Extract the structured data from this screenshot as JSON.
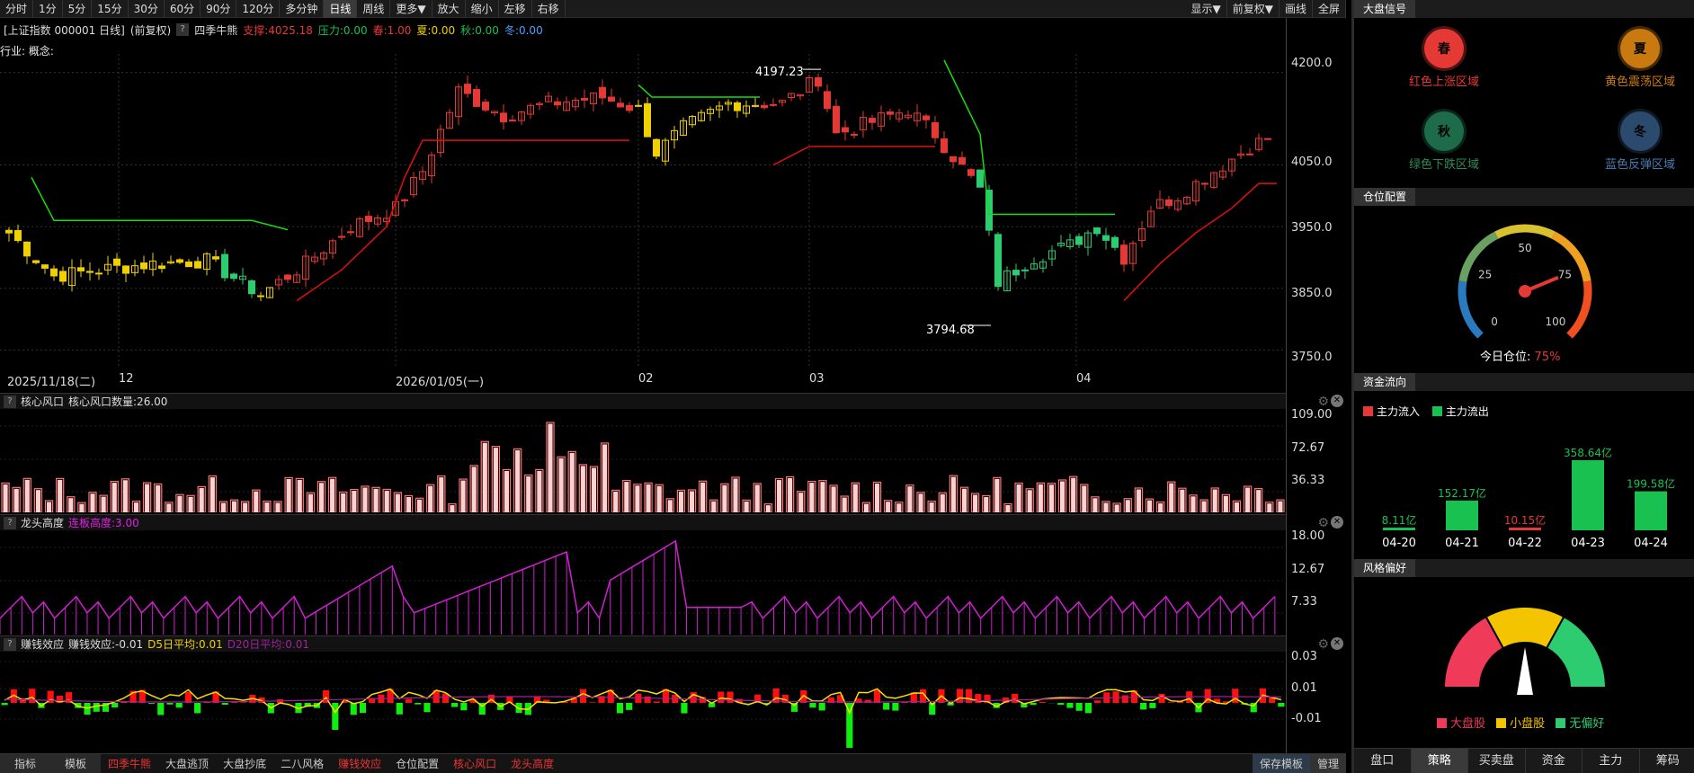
{
  "toolbar": {
    "periods": [
      "分时",
      "1分",
      "5分",
      "15分",
      "30分",
      "60分",
      "90分",
      "120分",
      "多分钟",
      "日线",
      "周线",
      "更多▼",
      "放大",
      "缩小",
      "左移",
      "右移"
    ],
    "active": "日线",
    "right": [
      "显示▼",
      "前复权▼",
      "画线",
      "全屏"
    ]
  },
  "info": {
    "title": "[上证指数 000001 日线]",
    "adjust": "(前复权)",
    "indicator": "四季牛熊",
    "support": "支撑:4025.18",
    "pressure": "压力:0.00",
    "spring": "春:1.00",
    "summer": "夏:0.00",
    "autumn": "秋:0.00",
    "winter": "冬:0.00"
  },
  "industry_label": "行业: 概念:",
  "main_axis": [
    "4200.0",
    "4050.0",
    "3950.0",
    "3850.0",
    "3750.0"
  ],
  "annot_high": "4197.23",
  "annot_low": "3794.68",
  "dates": [
    "2025/11/18(二)",
    "12",
    "2026/01/05(一)",
    "02",
    "03",
    "04"
  ],
  "sub1": {
    "q": "?",
    "name": "核心风口",
    "label": "核心风口数量:26.00",
    "axis": [
      "109.00",
      "72.67",
      "36.33"
    ]
  },
  "sub2": {
    "q": "?",
    "name": "龙头高度",
    "label": "连板高度:3.00",
    "axis": [
      "18.00",
      "12.67",
      "7.33"
    ]
  },
  "sub3": {
    "q": "?",
    "name": "赚钱效应",
    "label": "赚钱效应:-0.01",
    "d5": "D5日平均:0.01",
    "d20": "D20日平均:0.01",
    "axis": [
      "0.03",
      "0.01",
      "-0.01"
    ]
  },
  "bottom": {
    "left": [
      "指标",
      "模板"
    ],
    "items": [
      "四季牛熊",
      "大盘逃顶",
      "大盘抄底",
      "二八风格",
      "赚钱效应",
      "仓位配置",
      "核心风口",
      "龙头高度"
    ],
    "red_items": [
      "四季牛熊",
      "赚钱效应",
      "核心风口",
      "龙头高度"
    ],
    "right": [
      "保存模板",
      "管理"
    ]
  },
  "side": {
    "signal_title": "大盘信号",
    "seasons": [
      {
        "glyph": "春",
        "label": "红色上涨区域",
        "color": "#e53935"
      },
      {
        "glyph": "夏",
        "label": "黄色震荡区域",
        "color": "#c87a10"
      },
      {
        "glyph": "秋",
        "label": "绿色下跌区域",
        "color": "#1e6b4a"
      },
      {
        "glyph": "冬",
        "label": "蓝色反弹区域",
        "color": "#2c4a6e"
      }
    ],
    "position_title": "仓位配置",
    "gauge_ticks": [
      "0",
      "25",
      "50",
      "75",
      "100"
    ],
    "position_label": "今日仓位:",
    "position_value": "75%",
    "flow_title": "资金流向",
    "flow_in": "主力流入",
    "flow_out": "主力流出",
    "flow_dates": [
      "04-20",
      "04-21",
      "04-22",
      "04-23",
      "04-24"
    ],
    "flow_values": [
      "8.11亿",
      "152.17亿",
      "10.15亿",
      "358.64亿",
      "199.58亿"
    ],
    "style_title": "风格偏好",
    "style_legend": [
      "大盘股",
      "小盘股",
      "无偏好"
    ],
    "tabs": [
      "盘口",
      "策略",
      "买卖盘",
      "资金",
      "主力",
      "筹码"
    ],
    "active_tab": "策略"
  },
  "chart_data": {
    "type": "candlestick",
    "flow_bars": {
      "categories": [
        "04-20",
        "04-21",
        "04-22",
        "04-23",
        "04-24"
      ],
      "values": [
        8.11,
        152.17,
        10.15,
        358.64,
        199.58
      ],
      "colors": [
        "#19c150",
        "#19c150",
        "#e53935",
        "#19c150",
        "#19c150"
      ]
    },
    "position_gauge": 75
  }
}
